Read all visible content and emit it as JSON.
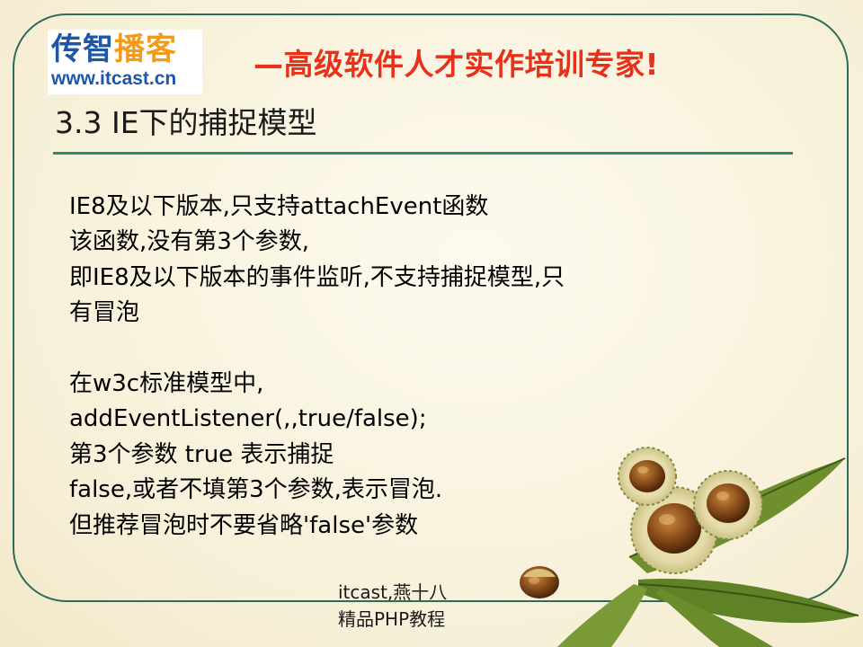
{
  "logo": {
    "brand_part1": "传智",
    "brand_part2": "播客",
    "url": "www.itcast.cn"
  },
  "slogan": "—高级软件人才实作培训专家!",
  "title": "3.3 IE下的捕捉模型",
  "body": {
    "lines": [
      "IE8及以下版本,只支持attachEvent函数",
      "该函数,没有第3个参数,",
      "即IE8及以下版本的事件监听,不支持捕捉模型,只",
      "有冒泡",
      "",
      "在w3c标准模型中,",
      "addEventListener(,,true/false);",
      "第3个参数 true 表示捕捉",
      "false,或者不填第3个参数,表示冒泡.",
      "但推荐冒泡时不要省略'false'参数"
    ]
  },
  "footer": {
    "line1": "itcast,燕十八",
    "line2": "精品PHP教程"
  },
  "colors": {
    "frame": "#2f6b5a",
    "rule": "#2a8a74",
    "slogan": "#e8311b",
    "logo_blue": "#1f57a8",
    "logo_orange": "#f39a1a"
  },
  "decoration": "chestnut-illustration"
}
